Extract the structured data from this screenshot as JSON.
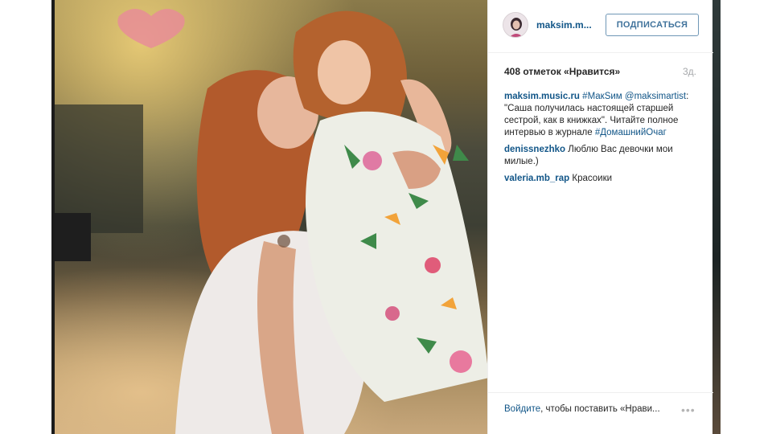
{
  "post": {
    "username": "maksim.m...",
    "follow_label": "ПОДПИСАТЬСЯ",
    "likes": "408 отметок «Нравится»",
    "time": "3д.",
    "caption": {
      "user": "maksim.music.ru",
      "tag1": "#МакSим",
      "mention": "@maksimartist",
      "text": ": \"Саша получилась настоящей старшей сестрой, как в книжках\". Читайте полное интервью в журнале ",
      "tag2": "#ДомашнийОчаг"
    },
    "comments": [
      {
        "user": "denissnezhko",
        "text": "Люблю Вас девочки мои милые.)"
      },
      {
        "user": "valeria.mb_rap",
        "text": "Красоики"
      }
    ],
    "footer": {
      "login_link": "Войдите",
      "login_rest": ", чтобы поставить «Нрави..."
    },
    "icons": {
      "more": "more-options-icon",
      "avatar": "profile-avatar"
    }
  }
}
